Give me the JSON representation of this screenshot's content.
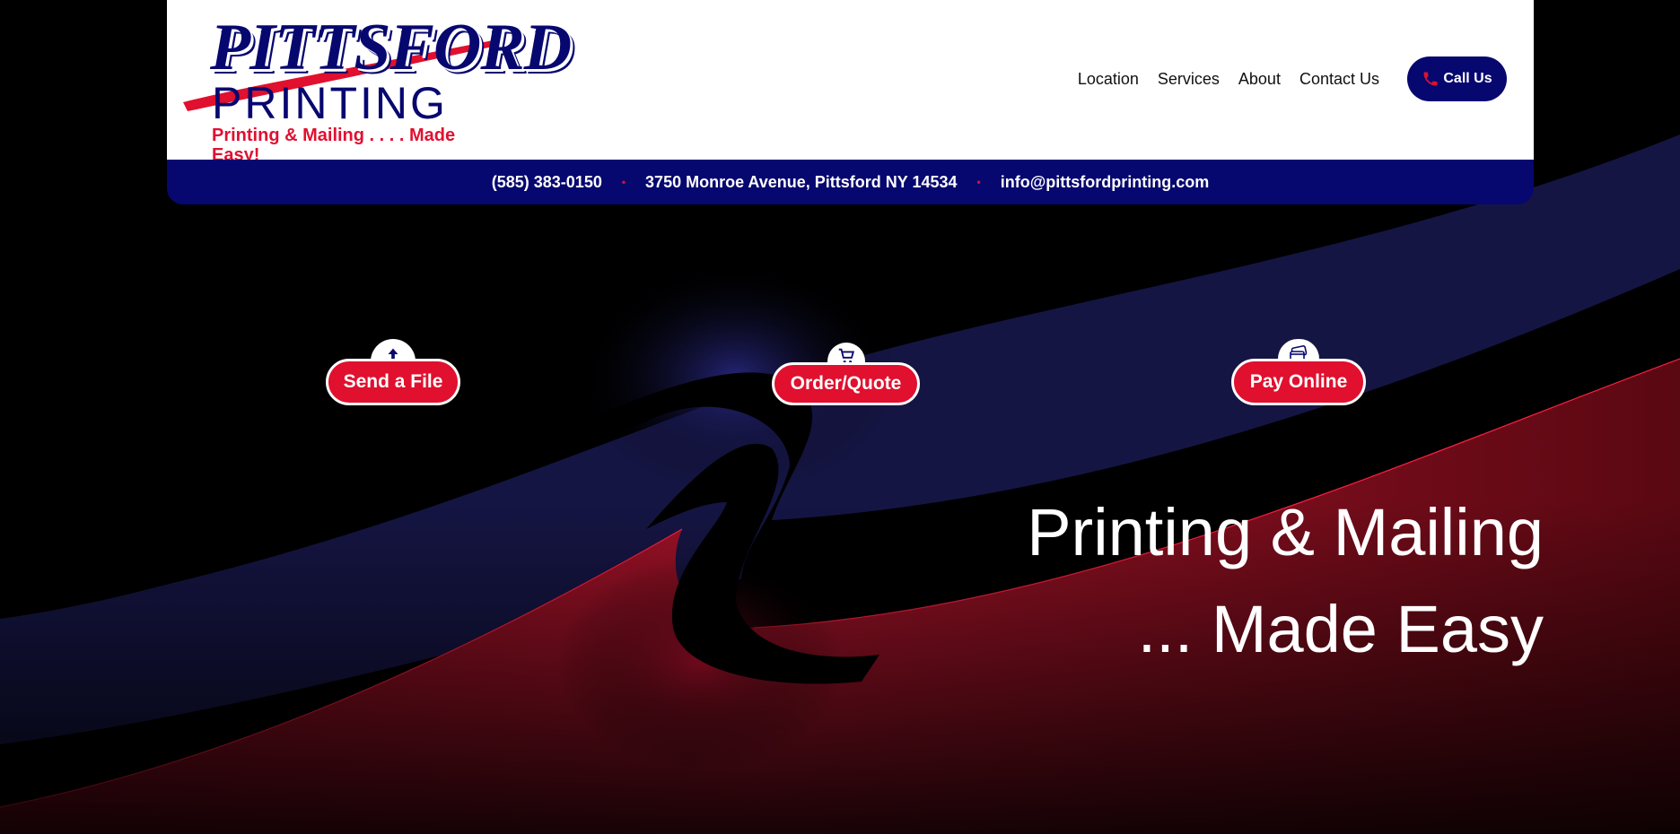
{
  "brand": {
    "logo_word": "PITTSFORD",
    "logo_sub": "PRINTING",
    "tagline": "Printing & Mailing . . . . Made Easy!",
    "colors": {
      "navy": "#070770",
      "red": "#e0102e",
      "white": "#ffffff"
    }
  },
  "nav": {
    "items": [
      {
        "label": "Location"
      },
      {
        "label": "Services"
      },
      {
        "label": "About"
      },
      {
        "label": "Contact Us"
      }
    ],
    "call_button": {
      "label": "Call Us",
      "icon": "phone-icon"
    }
  },
  "info_bar": {
    "phone": "(585) 383-0150",
    "address": "3750 Monroe Avenue, Pittsford NY 14534",
    "email": "info@pittsfordprinting.com",
    "separator": "•"
  },
  "actions": [
    {
      "label": "Send a File",
      "icon": "cloud-upload-icon"
    },
    {
      "label": "Order/Quote",
      "icon": "shopping-cart-icon"
    },
    {
      "label": "Pay Online",
      "icon": "credit-card-icon"
    }
  ],
  "hero": {
    "line1": "Printing & Mailing",
    "line2": "... Made Easy"
  }
}
